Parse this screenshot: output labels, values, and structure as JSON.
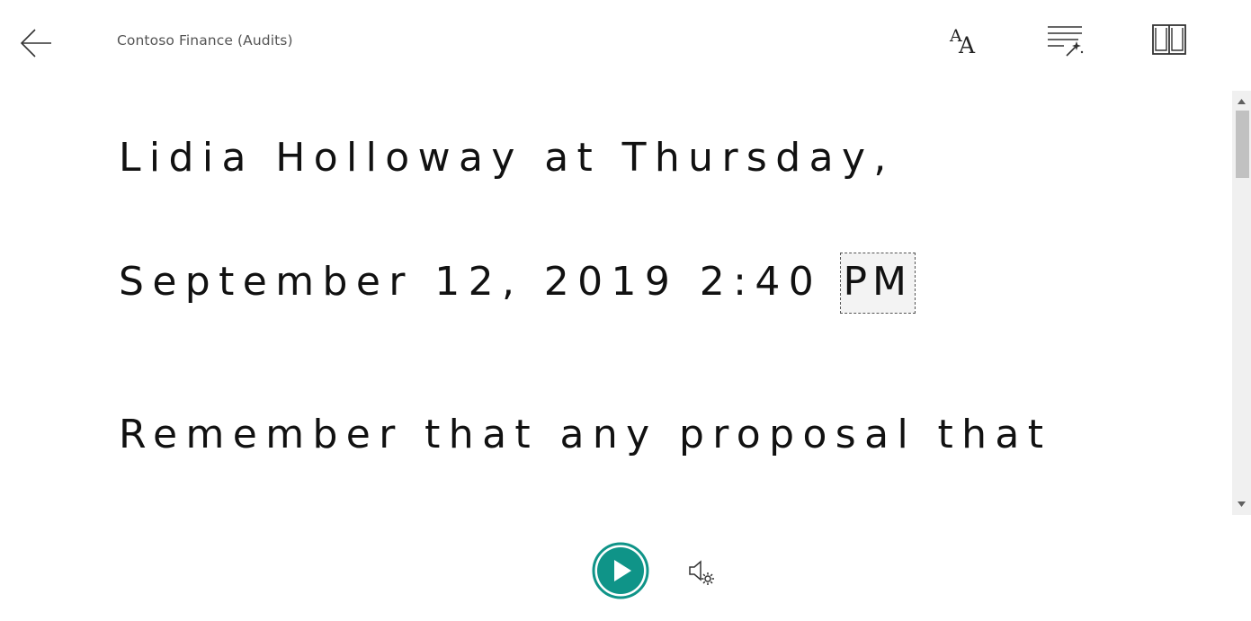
{
  "header": {
    "title": "Contoso Finance (Audits)"
  },
  "reader": {
    "lines": [
      {
        "text": "Lidia Holloway at Thursday,"
      },
      {
        "pre": "September 12, 2019 2:40 ",
        "focus": "PM"
      },
      {
        "text": "Remember that any proposal that"
      }
    ]
  },
  "colors": {
    "accent": "#0f9488",
    "text": "#111111",
    "title": "#555555"
  },
  "icons": {
    "back": "arrow-left-icon",
    "text_preferences": "text-size-icon",
    "grammar_options": "grammar-icon",
    "reading_preferences": "book-icon",
    "play": "play-icon",
    "voice_settings": "speaker-settings-icon"
  }
}
